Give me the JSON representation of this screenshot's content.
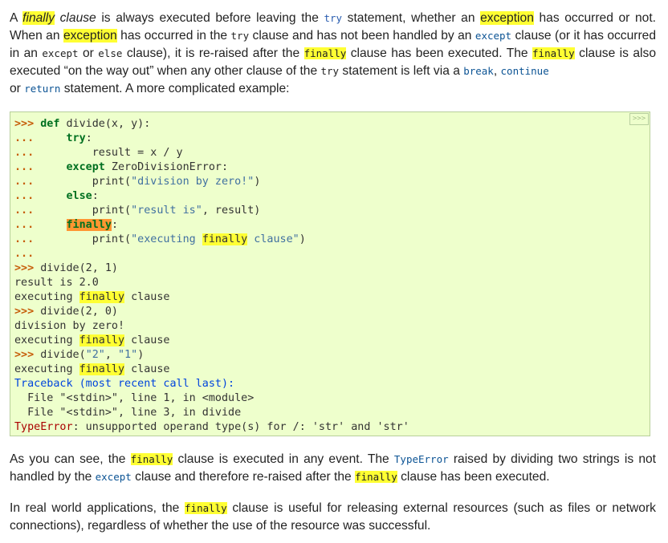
{
  "para1": {
    "t1": "A ",
    "finally_italic": "finally",
    "t2": " clause",
    "t3": " is always executed before leaving the ",
    "code_try": "try",
    "t4": " statement, whether an ",
    "exception1": "exception",
    "t5": " has occurred or not. When an ",
    "exception2": "exception",
    "t6": " has occurred in the ",
    "code_try2": "try",
    "t7": " clause and has not been handled by an ",
    "code_except": "except",
    "t8": " clause (or it has occurred in an ",
    "code_except2": "except",
    "t9": " or ",
    "code_else": "else",
    "t10": " clause), it is re-raised after the ",
    "finally1": "finally",
    "t11": " clause has been executed. The ",
    "finally2": "finally",
    "t12": " clause is also executed “on the way out” when any other clause of the ",
    "code_try3": "try",
    "t13": " statement is left via a ",
    "code_break": "break",
    "t14": ", ",
    "code_continue": "continue",
    "t15": " or ",
    "code_return": "return",
    "t16": " statement. A more complicated example:"
  },
  "code_block": {
    "copy_button": ">>>",
    "lines": {
      "l1_prompt": ">>>",
      "l1_kw": "def",
      "l1_rest": " divide(x, y):",
      "l2_prompt": "...",
      "l2_kw": "try",
      "l2_rest": ":",
      "l3_prompt": "...",
      "l3_rest": "        result = x / y",
      "l4_prompt": "...",
      "l4_kw": "except",
      "l4_rest": " ZeroDivisionError:",
      "l5_prompt": "...",
      "l5_pre": "        print(",
      "l5_str": "\"division by zero!\"",
      "l5_post": ")",
      "l6_prompt": "...",
      "l6_kw": "else",
      "l6_rest": ":",
      "l7_prompt": "...",
      "l7_pre": "        print(",
      "l7_str": "\"result is\"",
      "l7_post": ", result)",
      "l8_prompt": "...",
      "l8_kw": "finally",
      "l8_rest": ":",
      "l9_prompt": "...",
      "l9_pre": "        print(",
      "l9_str_a": "\"executing ",
      "l9_str_b": "finally",
      "l9_str_c": " clause\"",
      "l9_post": ")",
      "l10_prompt": "...",
      "l11_prompt": ">>>",
      "l11_rest": " divide(2, 1)",
      "l12": "result is 2.0",
      "l13_a": "executing ",
      "l13_b": "finally",
      "l13_c": " clause",
      "l14_prompt": ">>>",
      "l14_rest": " divide(2, 0)",
      "l15": "division by zero!",
      "l16_a": "executing ",
      "l16_b": "finally",
      "l16_c": " clause",
      "l17_prompt": ">>>",
      "l17_pre": " divide(",
      "l17_s1": "\"2\"",
      "l17_mid": ", ",
      "l17_s2": "\"1\"",
      "l17_post": ")",
      "l18_a": "executing ",
      "l18_b": "finally",
      "l18_c": " clause",
      "l19": "Traceback (most recent call last):",
      "l20": "  File \"<stdin>\", line 1, in <module>",
      "l21": "  File \"<stdin>\", line 3, in divide",
      "l22_err": "TypeError",
      "l22_rest": ": unsupported operand type(s) for /: 'str' and 'str'"
    }
  },
  "para2": {
    "t1": "As you can see, the ",
    "finally1": "finally",
    "t2": " clause is executed in any event. The ",
    "code_typeerror": "TypeError",
    "t3": " raised by dividing two strings is not handled by the ",
    "code_except": "except",
    "t4": " clause and therefore re-raised after the ",
    "finally2": "finally",
    "t5": " clause has been executed."
  },
  "para3": {
    "t1": "In real world applications, the ",
    "finally1": "finally",
    "t2": " clause is useful for releasing external resources (such as files or network connections), regardless of whether the use of the resource was successful."
  }
}
